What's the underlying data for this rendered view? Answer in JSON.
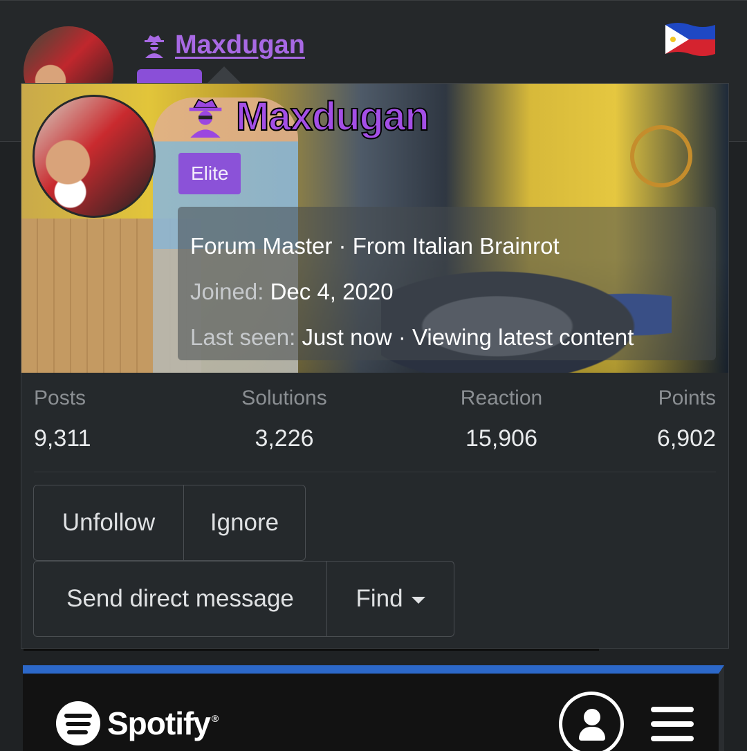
{
  "header": {
    "username": "Maxdugan",
    "flag_icon": "philippines-flag-icon"
  },
  "card": {
    "username": "Maxdugan",
    "rank_icon": "spy-icon",
    "badge": "Elite",
    "info": {
      "title": "Forum Master",
      "separator": " · ",
      "location": "From Italian Brainrot",
      "joined_label": "Joined:",
      "joined_value": "Dec 4, 2020",
      "lastseen_label": "Last seen:",
      "lastseen_value": "Just now",
      "activity": "Viewing latest content"
    },
    "stats": [
      {
        "label": "Posts",
        "value": "9,311"
      },
      {
        "label": "Solutions",
        "value": "3,226"
      },
      {
        "label": "Reaction",
        "value": "15,906"
      },
      {
        "label": "Points",
        "value": "6,902"
      }
    ],
    "buttons": {
      "unfollow": "Unfollow",
      "ignore": "Ignore",
      "message": "Send direct message",
      "find": "Find"
    }
  },
  "spotify": {
    "brand": "Spotify",
    "trademark": "®",
    "icons": [
      "spotify-logo-icon",
      "user-icon",
      "menu-icon"
    ]
  },
  "colors": {
    "accent_purple": "#8b52d8",
    "username_purple": "#a44fe6",
    "spotify_bar": "#2c68c9"
  }
}
